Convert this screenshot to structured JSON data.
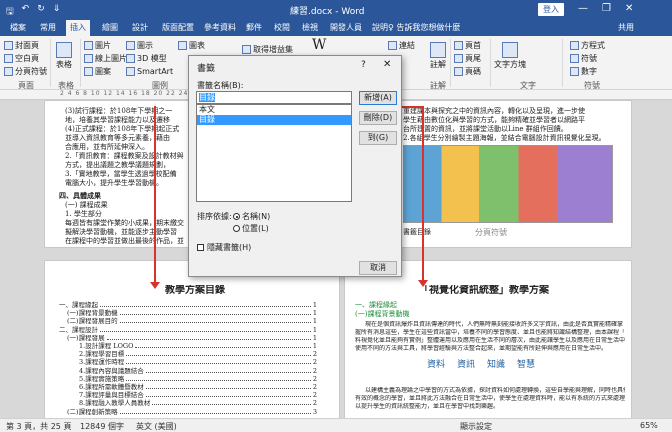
{
  "window": {
    "title": "練習.docx - Word",
    "login": "登入",
    "minimize": "—",
    "restore": "❐",
    "close": "✕"
  },
  "qat": {
    "save": "🖫",
    "undo": "↶",
    "redo": "↻",
    "more": "⇓"
  },
  "tabs": [
    "檔案",
    "常用",
    "插入",
    "繪圖",
    "設計",
    "版面配置",
    "參考資料",
    "郵件",
    "校閱",
    "檢視",
    "開發人員",
    "說明"
  ],
  "active_tab": "插入",
  "tell_me": "♀ 告訴我您想做什麼",
  "user": "♂ 共用",
  "share": "共用",
  "ribbon": {
    "pages": {
      "cover": "封面頁",
      "blank": "空白頁",
      "break": "分頁符號",
      "label": "頁面"
    },
    "tables": {
      "table": "表格",
      "label": "表格"
    },
    "illustrations": {
      "pictures": "圖片",
      "online": "線上圖片",
      "shapes": "圖案",
      "icons": "圖示",
      "models": "3D 模型",
      "smartart": "SmartArt",
      "chart": "圖表",
      "screenshot": "螢幕擷取畫面",
      "label": "圖例"
    },
    "addins": {
      "get": "取得增益集",
      "wiki": "Wikipedia"
    },
    "links": {
      "link": "連結"
    },
    "comments": {
      "comment": "註解",
      "label": "註解"
    },
    "header": {
      "header": "頁首",
      "footer": "頁尾",
      "pagenum": "頁碼"
    },
    "text": {
      "textbox": "文字方塊",
      "label": "文字"
    },
    "symbols": {
      "equation": "方程式",
      "symbol": "符號",
      "number": "數字",
      "label": "符號"
    }
  },
  "ruler_numbers": "2  4  6  8  10  12  14  16  18  20  22  24  26  28  30  32  34  36  38  40  42  44  46  48",
  "dialog": {
    "title": "書籤",
    "help": "?",
    "close": "✕",
    "name_label": "書籤名稱(B):",
    "name_value": "目錄",
    "list": [
      "本文",
      "目錄"
    ],
    "selected_index": 1,
    "add": "新增(A)",
    "delete": "刪除(D)",
    "goto": "到(G)",
    "sort_label": "排序依據:",
    "sort_name": "名稱(N)",
    "sort_location": "位置(L)",
    "hidden": "隱藏書籤(H)",
    "cancel": "取消"
  },
  "document": {
    "top_left_lines": [
      "(3)試行課程：於108年下學期之一",
      "   地，培養其學習課程能力以及遷移",
      "(4)正式課程：於108年下學期起正式",
      "   並導入資訊教育等多元素養，藉由",
      "   合應用，並有所延伸深入。",
      "2.「資訊教育：課程教案及設計教材與",
      "   方式，提出議題之教學議題規劃，",
      "3.「實地教學，當學生透過學校配備",
      "   電腦大小，提升學生學習動機。"
    ],
    "top_left_section": "四、具體成果",
    "top_left_items": [
      "(一) 課程成果",
      "   1. 學生部分",
      "      每週皆有課堂作業的小成果，期末繳交",
      "      擬解決學習動機，並能逐步主動學習",
      "      在課程中的學習並做出最後的作品，並",
      "      實際成果簡報，也融入在日常生活中"
    ],
    "top_right_lines": [
      "重建課本與探究之中的資訊內容，轉化以及呈現，進一步使",
      "學生藉由數位化與學習的方式，能夠精確並學習者以網路平",
      "台所建置的資訊，並將課堂活動以Line 群組作回饋。",
      "2.各組學生分別繪製主題海報，並結合電腦設計資訊視覺化呈現。"
    ],
    "section_break": "分頁符號",
    "bookmark_caption": "書籤目錄",
    "bottom_left_title": "教學方案目錄",
    "toc": [
      {
        "text": "一、課程緣起",
        "page": "1"
      },
      {
        "text": "(一)課程背景動機",
        "page": "1"
      },
      {
        "text": "(二)課程發展目的",
        "page": "1"
      },
      {
        "text": "二、課程設計",
        "page": "1"
      },
      {
        "text": "(一)課程發展",
        "page": "1"
      },
      {
        "text": "1.設計課程 LOGO",
        "page": "1"
      },
      {
        "text": "2.課程學習目標",
        "page": "2"
      },
      {
        "text": "3.課程運作時程",
        "page": "2"
      },
      {
        "text": "4.課程內容與議題結合",
        "page": "2"
      },
      {
        "text": "5.課程實施策略",
        "page": "2"
      },
      {
        "text": "6.課程所需軟體暨教材",
        "page": "2"
      },
      {
        "text": "7.課程評量與目標結合",
        "page": "2"
      },
      {
        "text": "8.課程融入教學人員教材",
        "page": "2"
      },
      {
        "text": "(二)課程創新策略",
        "page": "3"
      }
    ],
    "bottom_right_title": "「視覺化資訊統整」教學方案",
    "bottom_right_h1": "一、課程緣起",
    "bottom_right_h2": "(一)課程背景動機",
    "bottom_right_lines": [
      "現在是個資訊爆炸且資訊傳達的時代，人們無時無刻能接收許多文字資訊，由此是否真實能精確掌",
      "握所有消息這些，學生在這些資訊當中，培養不同的學習態度、並且也能將知識結構整理，由本課程「資",
      "料視覺化並且能夠有實例」整體運用以及應用在生活不同的層次，由此能讓學生以及應用在日常生活中，",
      "使用不同的方法與工具，將學習經驗與方法整合起來，並期望能有所延伸與應用在日常生活中。"
    ],
    "bottom_right_lines2": [
      "以建構主義為理論之中學習的方式為依據，探討資料如何處理轉換，這些自學能與理解，同時也具備",
      "有效的概念的學習，並且將此方法融合在日常生活中，使學生在處理資料時，能以有系統的方式來處理，",
      "以提升學生的資訊統整能力，並且在學習中找到樂趣。"
    ],
    "flow_words": [
      "資料",
      "資訊",
      "知識",
      "智慧"
    ]
  },
  "status": {
    "page": "第 3 頁，共 25 頁",
    "words": "12849 個字",
    "lang": "英文 (美國)",
    "focus": "顯示設定",
    "zoom": "65%"
  },
  "colors": {
    "accent": "#2b579a",
    "annotation": "#d9312b",
    "selection": "#3399ff"
  }
}
